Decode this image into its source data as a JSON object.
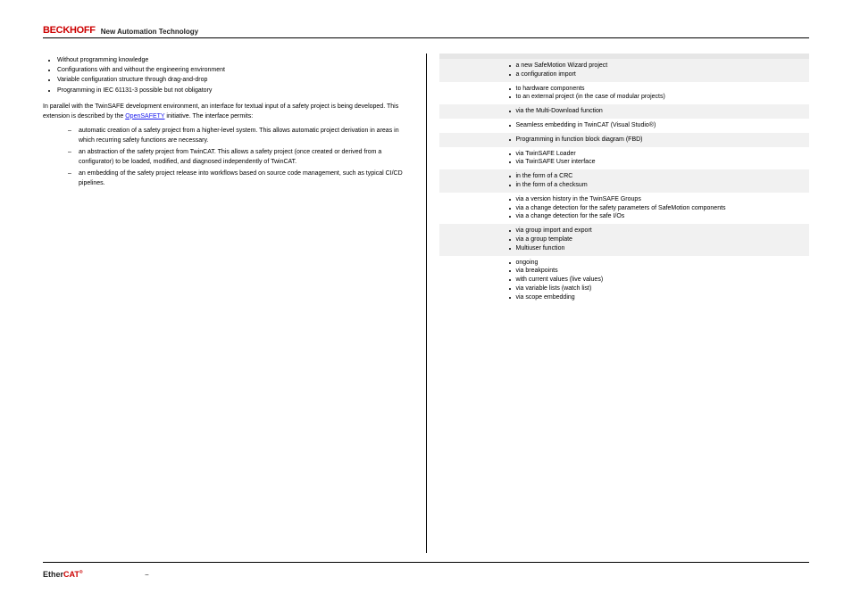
{
  "header": {
    "brand": "BECKHOFF",
    "tagline": "New Automation Technology"
  },
  "left": {
    "bullets": [
      "Without programming knowledge",
      "Configurations with and without the engineering environment",
      "Variable configuration structure through drag-and-drop",
      "Programming in IEC 61131-3 possible but not obligatory"
    ],
    "para1_a": "In parallel with the TwinSAFE development environment, an interface for textual input of a safety project is being developed. This extension is described by the ",
    "link": "OpenSAFETY",
    "para1_b": " initiative. The interface permits:",
    "subs": [
      "automatic creation of a safety project from a higher-level system. This allows automatic project derivation in areas in which recurring safety functions are necessary.",
      "an abstraction of the safety project from TwinCAT. This allows a safety project (once created or derived from a configurator) to be loaded, modified, and diagnosed independently of TwinCAT.",
      "an embedding of the safety project release into workflows based on source code management, such as typical CI/CD pipelines."
    ]
  },
  "table": {
    "headers": [
      "",
      ""
    ],
    "rows": [
      {
        "k": "",
        "v": [
          "a new SafeMotion Wizard project",
          "a configuration import"
        ]
      },
      {
        "k": "",
        "v": [
          "to hardware components",
          "to an external project (in the case of modular projects)"
        ]
      },
      {
        "k": "",
        "v": [
          "via the Multi-Download function"
        ]
      },
      {
        "k": "",
        "v": [
          "Seamless embedding in TwinCAT (Visual Studio®)"
        ]
      },
      {
        "k": "",
        "v": [
          "Programming in function block diagram (FBD)"
        ]
      },
      {
        "k": "",
        "v": [
          "via TwinSAFE Loader",
          "via TwinSAFE User interface"
        ]
      },
      {
        "k": "",
        "v": [
          "in the form of a CRC",
          "in the form of a checksum"
        ]
      },
      {
        "k": "",
        "v": [
          "via a version history in the TwinSAFE Groups",
          "via a change detection for the safety parameters of SafeMotion components",
          "via a change detection for the safe I/Os"
        ]
      },
      {
        "k": "",
        "v": [
          "via group import and export",
          "via a group template",
          "Multiuser function"
        ]
      },
      {
        "k": "",
        "v": [
          "ongoing",
          "via breakpoints",
          "with current values (live values)",
          "via variable lists (watch list)",
          "via scope embedding"
        ]
      }
    ]
  },
  "footer": {
    "ecat_a": "Ether",
    "ecat_b": "CAT",
    "ecat_sup": "®",
    "sep": "–",
    "num": ""
  }
}
